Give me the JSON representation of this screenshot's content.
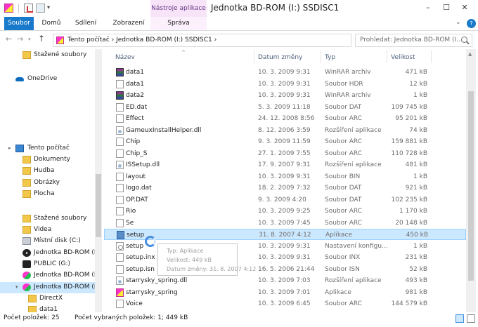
{
  "title_bar": {
    "contextual_tab_title": "Nástroje aplikace",
    "window_title": "Jednotka BD-ROM (I:) SSDISC1",
    "minimize": "–",
    "maximize": "☐",
    "close": "✕"
  },
  "ribbon": {
    "tabs": [
      "Soubor",
      "Domů",
      "Sdílení",
      "Zobrazení",
      "Správa"
    ],
    "expand": "⌄",
    "help": "?"
  },
  "address": {
    "path": "Tento počítač  ›  Jednotka BD-ROM (I:) SSDISC1  ›",
    "search_placeholder": "Prohledat: Jednotka BD-ROM (I...",
    "back": "←",
    "forward": "→",
    "recent": "▾",
    "up": "↑",
    "dropdown": "▾",
    "refresh": "⟳"
  },
  "nav_pane": {
    "items": [
      {
        "label": "Stažené soubory",
        "icon": "downloads-folder-icon"
      },
      {
        "label": "OneDrive",
        "icon": "onedrive-icon"
      },
      {
        "label": "Tento počítač",
        "icon": "this-pc-icon"
      },
      {
        "label": "Dokumenty",
        "icon": "documents-folder-icon"
      },
      {
        "label": "Hudba",
        "icon": "music-folder-icon"
      },
      {
        "label": "Obrázky",
        "icon": "pictures-folder-icon"
      },
      {
        "label": "Plocha",
        "icon": "desktop-folder-icon"
      },
      {
        "label": "Stažené soubory",
        "icon": "downloads-folder-icon"
      },
      {
        "label": "Videa",
        "icon": "videos-folder-icon"
      },
      {
        "label": "Místní disk (C:)",
        "icon": "local-disk-icon"
      },
      {
        "label": "Jednotka BD-ROM (D",
        "icon": "bd-rom-drive-icon"
      },
      {
        "label": "PUBLIC (G:)",
        "icon": "network-drive-icon"
      },
      {
        "label": "Jednotka BD-ROM (H",
        "icon": "bd-rom-drive-icon"
      },
      {
        "label": "Jednotka BD-ROM (I:",
        "icon": "bd-rom-drive-icon"
      },
      {
        "label": "DirectX",
        "icon": "folder-icon"
      },
      {
        "label": "data1",
        "icon": "folder-icon"
      }
    ]
  },
  "file_list": {
    "columns": {
      "name": "Název",
      "date": "Datum změny",
      "type": "Typ",
      "size": "Velikost"
    },
    "rows": [
      {
        "name": "data1",
        "date": "10. 3. 2009 9:31",
        "type": "WinRAR archiv",
        "size": "471 kB",
        "icon": "winrar-archive-icon"
      },
      {
        "name": "data1",
        "date": "10. 3. 2009 9:31",
        "type": "Soubor HDR",
        "size": "12 kB",
        "icon": "file-icon"
      },
      {
        "name": "data2",
        "date": "10. 3. 2009 9:31",
        "type": "WinRAR archiv",
        "size": "1 kB",
        "icon": "winrar-archive-icon"
      },
      {
        "name": "ED.dat",
        "date": "5. 3. 2009 11:18",
        "type": "Soubor DAT",
        "size": "109 745 kB",
        "icon": "file-icon"
      },
      {
        "name": "Effect",
        "date": "24. 12. 2008 8:56",
        "type": "Soubor ARC",
        "size": "95 201 kB",
        "icon": "file-icon"
      },
      {
        "name": "GameuxInstallHelper.dll",
        "date": "8. 12. 2006 3:59",
        "type": "Rozšíření aplikace",
        "size": "74 kB",
        "icon": "dll-icon"
      },
      {
        "name": "Chip",
        "date": "9. 3. 2009 11:59",
        "type": "Soubor ARC",
        "size": "159 881 kB",
        "icon": "file-icon"
      },
      {
        "name": "Chip_S",
        "date": "27. 1. 2009 7:55",
        "type": "Soubor ARC",
        "size": "110 728 kB",
        "icon": "file-icon"
      },
      {
        "name": "ISSetup.dll",
        "date": "17. 9. 2007 9:31",
        "type": "Rozšíření aplikace",
        "size": "481 kB",
        "icon": "dll-icon"
      },
      {
        "name": "layout",
        "date": "10. 3. 2009 9:31",
        "type": "Soubor BIN",
        "size": "1 kB",
        "icon": "file-icon"
      },
      {
        "name": "logo.dat",
        "date": "18. 2. 2009 7:32",
        "type": "Soubor DAT",
        "size": "921 kB",
        "icon": "file-icon"
      },
      {
        "name": "OP.DAT",
        "date": "9. 3. 2009 4:20",
        "type": "Soubor DAT",
        "size": "102 235 kB",
        "icon": "file-icon"
      },
      {
        "name": "Rio",
        "date": "10. 3. 2009 9:25",
        "type": "Soubor ARC",
        "size": "1 170 kB",
        "icon": "file-icon"
      },
      {
        "name": "Se",
        "date": "10. 3. 2009 7:45",
        "type": "Soubor ARC",
        "size": "20 148 kB",
        "icon": "file-icon"
      },
      {
        "name": "setup",
        "date": "31. 8. 2007 4:12",
        "type": "Aplikace",
        "size": "450 kB",
        "icon": "setup-app-icon",
        "selected": true
      },
      {
        "name": "setup",
        "date": "10. 3. 2009 9:31",
        "type": "Nastavení konfigu...",
        "size": "1 kB",
        "icon": "config-file-icon"
      },
      {
        "name": "setup.inx",
        "date": "10. 3. 2009 9:31",
        "type": "Soubor INX",
        "size": "231 kB",
        "icon": "file-icon"
      },
      {
        "name": "setup.isn",
        "date": "16. 5. 2006 21:44",
        "type": "Soubor ISN",
        "size": "52 kB",
        "icon": "file-icon"
      },
      {
        "name": "starrysky_spring.dll",
        "date": "10. 3. 2009 7:03",
        "type": "Rozšíření aplikace",
        "size": "493 kB",
        "icon": "dll-icon"
      },
      {
        "name": "starrysky_spring",
        "date": "10. 3. 2009 7:01",
        "type": "Aplikace",
        "size": "981 kB",
        "icon": "app-icon"
      },
      {
        "name": "Voice",
        "date": "10. 3. 2009 6:45",
        "type": "Soubor ARC",
        "size": "144 579 kB",
        "icon": "file-icon"
      }
    ]
  },
  "tooltip": {
    "type": "Typ: Aplikace",
    "size": "Velikost: 449 kB",
    "modified": "Datum změny: 31. 8. 2007 4:12"
  },
  "status_bar": {
    "item_count": "Počet položek: 25",
    "selected_info": "Počet vybraných položek: 1; 449 kB"
  }
}
